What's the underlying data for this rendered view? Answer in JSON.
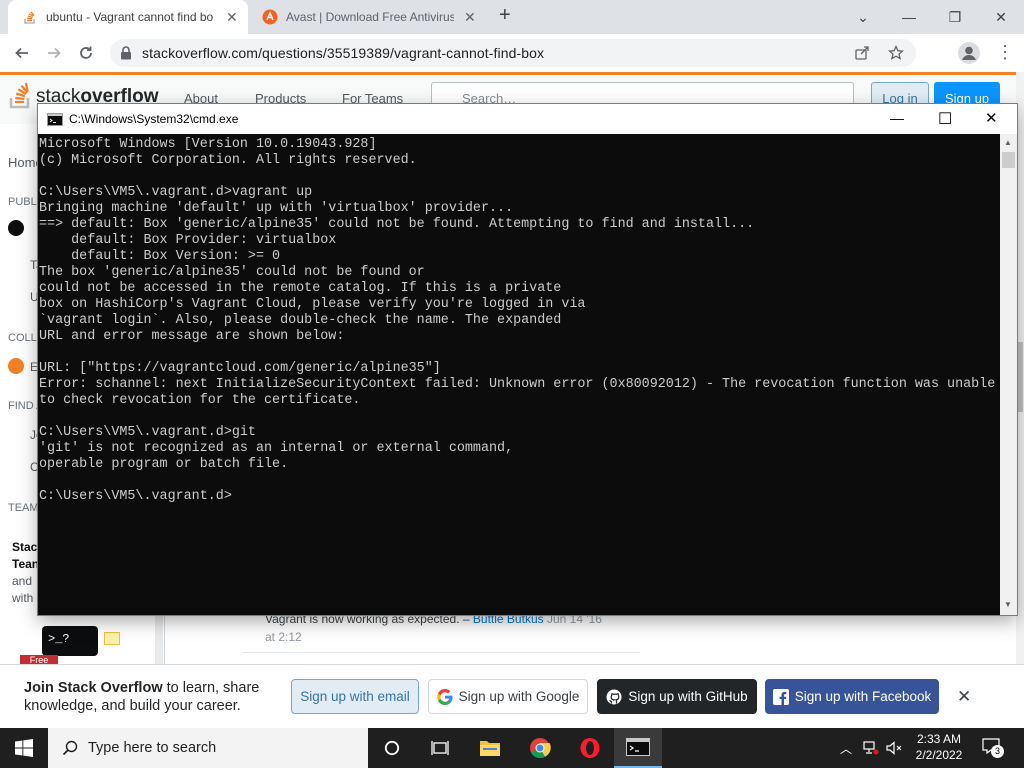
{
  "browser": {
    "tabs": [
      {
        "title": "ubuntu - Vagrant cannot find bo",
        "active": true,
        "icon": "stackoverflow-icon"
      },
      {
        "title": "Avast | Download Free Antivirus",
        "active": false,
        "icon": "avast-icon"
      }
    ],
    "new_tab": "+",
    "window_controls": {
      "minimize": "⌄",
      "minimize2": "—",
      "restore": "❐",
      "close": "✕"
    },
    "url": "stackoverflow.com/questions/35519389/vagrant-cannot-find-box"
  },
  "so": {
    "logo_stack": "stack",
    "logo_overflow": "overflow",
    "nav": [
      "About",
      "Products",
      "For Teams"
    ],
    "search_placeholder": "Search…",
    "login": "Log in",
    "signup": "Sign up",
    "sidebar": {
      "home": "Home",
      "public": "PUBLIC",
      "collectives": "COLLE",
      "explore": "E",
      "find": "FIND A",
      "teams": "TEAMS",
      "teams_title1": "Stac",
      "teams_title2": "Tean",
      "teams_text1": "and",
      "teams_text2": "with",
      "free": "Free",
      "j": "Jo",
      "c": "C",
      "t": "Ta",
      "u": "U",
      "prompt": ">_?"
    },
    "comment": {
      "text": "Vagrant is now working as expected. –",
      "author": "Buttle Butkus",
      "date": "Jun 14 '16",
      "time": "at 2:12"
    },
    "join": {
      "title": "Join Stack Overflow",
      "text1": " to learn, share",
      "text2": "knowledge, and build your career.",
      "email": "Sign up with email",
      "google": "Sign up with Google",
      "github": "Sign up with GitHub",
      "facebook": "Sign up with Facebook",
      "close": "✕"
    }
  },
  "cmd": {
    "title": "C:\\Windows\\System32\\cmd.exe",
    "controls": {
      "minimize": "—",
      "maximize": "☐",
      "close": "✕"
    },
    "lines": [
      "Microsoft Windows [Version 10.0.19043.928]",
      "(c) Microsoft Corporation. All rights reserved.",
      "",
      "C:\\Users\\VM5\\.vagrant.d>vagrant up",
      "Bringing machine 'default' up with 'virtualbox' provider...",
      "==> default: Box 'generic/alpine35' could not be found. Attempting to find and install...",
      "    default: Box Provider: virtualbox",
      "    default: Box Version: >= 0",
      "The box 'generic/alpine35' could not be found or",
      "could not be accessed in the remote catalog. If this is a private",
      "box on HashiCorp's Vagrant Cloud, please verify you're logged in via",
      "`vagrant login`. Also, please double-check the name. The expanded",
      "URL and error message are shown below:",
      "",
      "URL: [\"https://vagrantcloud.com/generic/alpine35\"]",
      "Error: schannel: next InitializeSecurityContext failed: Unknown error (0x80092012) - The revocation function was unable",
      "to check revocation for the certificate.",
      "",
      "C:\\Users\\VM5\\.vagrant.d>git",
      "'git' is not recognized as an internal or external command,",
      "operable program or batch file.",
      "",
      "C:\\Users\\VM5\\.vagrant.d>"
    ]
  },
  "taskbar": {
    "search_placeholder": "Type here to search",
    "time": "2:33 AM",
    "date": "2/2/2022",
    "notifications": "3"
  }
}
